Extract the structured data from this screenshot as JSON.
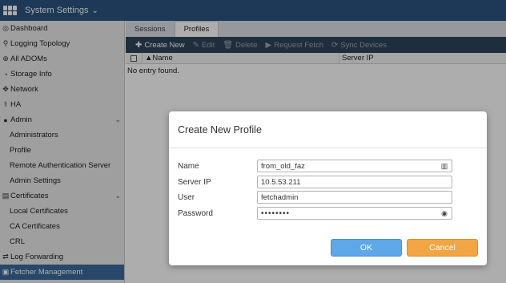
{
  "app": {
    "title": "System Settings",
    "title_chevron": "chevron-down-icon"
  },
  "sidebar": {
    "items": [
      {
        "label": "Dashboard",
        "icon": "dashboard-icon",
        "glyph": "◎"
      },
      {
        "label": "Logging Topology",
        "icon": "topology-icon",
        "glyph": "⚲"
      },
      {
        "label": "All ADOMs",
        "icon": "globe-icon",
        "glyph": "⊕"
      },
      {
        "label": "Storage Info",
        "icon": "storage-icon",
        "glyph": "◔"
      },
      {
        "label": "Network",
        "icon": "network-icon",
        "glyph": "✥"
      },
      {
        "label": "HA",
        "icon": "ha-icon",
        "glyph": "⚕"
      },
      {
        "label": "Admin",
        "icon": "user-icon",
        "glyph": "●",
        "expand": "⌄"
      },
      {
        "label": "Administrators",
        "sub": true
      },
      {
        "label": "Profile",
        "sub": true
      },
      {
        "label": "Remote Authentication Server",
        "sub": true
      },
      {
        "label": "Admin Settings",
        "sub": true
      },
      {
        "label": "Certificates",
        "icon": "certificate-icon",
        "glyph": "▤",
        "expand": "⌄"
      },
      {
        "label": "Local Certificates",
        "sub": true
      },
      {
        "label": "CA Certificates",
        "sub": true
      },
      {
        "label": "CRL",
        "sub": true
      },
      {
        "label": "Log Forwarding",
        "icon": "forward-icon",
        "glyph": "⇄"
      },
      {
        "label": "Fetcher Management",
        "icon": "fetcher-icon",
        "glyph": "▣",
        "active": true
      }
    ]
  },
  "main": {
    "tabs": [
      {
        "label": "Sessions",
        "selected": false
      },
      {
        "label": "Profiles",
        "selected": true
      }
    ],
    "toolbar": {
      "create_new": "Create New",
      "edit": "Edit",
      "delete": "Delete",
      "request_fetch": "Request Fetch",
      "sync_devices": "Sync Devices"
    },
    "table": {
      "col_name": "▲Name",
      "col_server_ip": "Server IP",
      "empty_message": "No entry found."
    }
  },
  "modal": {
    "title": "Create New Profile",
    "fields": {
      "name": {
        "label": "Name",
        "value": "from_old_faz"
      },
      "server_ip": {
        "label": "Server IP",
        "value": "10.5.53.211"
      },
      "user": {
        "label": "User",
        "value": "fetchadmin"
      },
      "password": {
        "label": "Password",
        "value": "••••••••"
      }
    },
    "ok_label": "OK",
    "cancel_label": "Cancel"
  },
  "colors": {
    "topbar": "#2b5580",
    "toolbar": "#2f4459",
    "active_nav": "#3a6a9b",
    "ok_button": "#5ea7e8",
    "cancel_button": "#f1a544"
  }
}
